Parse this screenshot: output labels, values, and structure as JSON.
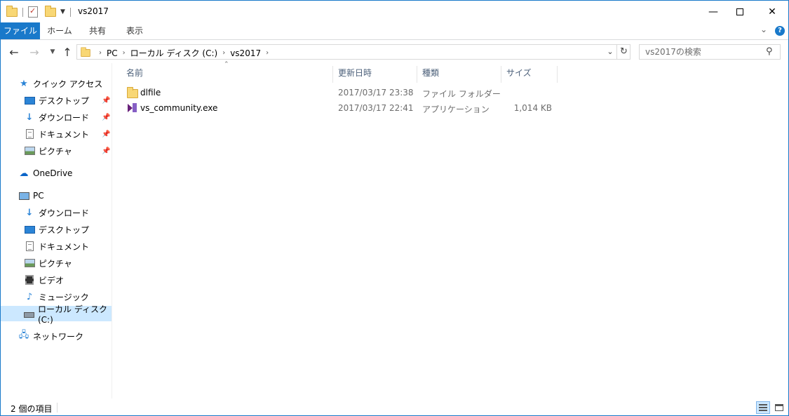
{
  "window": {
    "title": "vs2017",
    "minimize_glyph": "—",
    "close_glyph": "✕"
  },
  "ribbon": {
    "tabs": [
      {
        "label": "ファイル"
      },
      {
        "label": "ホーム"
      },
      {
        "label": "共有"
      },
      {
        "label": "表示"
      }
    ],
    "expand_glyph": "⌄",
    "help_glyph": "?"
  },
  "nav": {
    "back_glyph": "←",
    "forward_glyph": "→",
    "recent_glyph": "▼",
    "up_glyph": "↑",
    "breadcrumb": [
      "PC",
      "ローカル ディスク (C:)",
      "vs2017"
    ],
    "crumb_separator": "›",
    "dropdown_glyph": "⌄",
    "refresh_glyph": "↻"
  },
  "search": {
    "placeholder": "vs2017の検索",
    "icon": "search-icon",
    "glyph": "⚲"
  },
  "sidebar": {
    "quick_access": {
      "label": "クイック アクセス",
      "icon": "star-icon",
      "glyph": "★"
    },
    "quick_items": [
      {
        "label": "デスクトップ",
        "icon": "desktop-icon",
        "pinned": true
      },
      {
        "label": "ダウンロード",
        "icon": "download-icon",
        "pinned": true
      },
      {
        "label": "ドキュメント",
        "icon": "document-icon",
        "pinned": true
      },
      {
        "label": "ピクチャ",
        "icon": "picture-icon",
        "pinned": true
      }
    ],
    "pin_glyph": "📌",
    "onedrive": {
      "label": "OneDrive",
      "icon": "cloud-icon",
      "glyph": "☁"
    },
    "pc": {
      "label": "PC",
      "icon": "pc-icon"
    },
    "pc_items": [
      {
        "label": "ダウンロード",
        "icon": "download-icon"
      },
      {
        "label": "デスクトップ",
        "icon": "desktop-icon"
      },
      {
        "label": "ドキュメント",
        "icon": "document-icon"
      },
      {
        "label": "ピクチャ",
        "icon": "picture-icon"
      },
      {
        "label": "ビデオ",
        "icon": "video-icon"
      },
      {
        "label": "ミュージック",
        "icon": "music-icon"
      },
      {
        "label": "ローカル ディスク (C:)",
        "icon": "drive-icon",
        "selected": true
      }
    ],
    "download_glyph": "↓",
    "music_glyph": "♪",
    "network": {
      "label": "ネットワーク",
      "icon": "network-icon",
      "glyph": "🖧"
    }
  },
  "file_list": {
    "sort_glyph": "⌃",
    "columns": [
      "名前",
      "更新日時",
      "種類",
      "サイズ"
    ],
    "rows": [
      {
        "name": "dlfile",
        "modified": "2017/03/17 23:38",
        "type": "ファイル フォルダー",
        "size": "",
        "icon": "folder-icon"
      },
      {
        "name": "vs_community.exe",
        "modified": "2017/03/17 22:41",
        "type": "アプリケーション",
        "size": "1,014 KB",
        "icon": "visual-studio-icon"
      }
    ]
  },
  "status": {
    "item_count": "2 個の項目"
  },
  "colors": {
    "accent": "#1979ca",
    "selected_bg": "#cce8ff",
    "header_text": "#4c607a",
    "secondary_text": "#6d6d6d"
  }
}
